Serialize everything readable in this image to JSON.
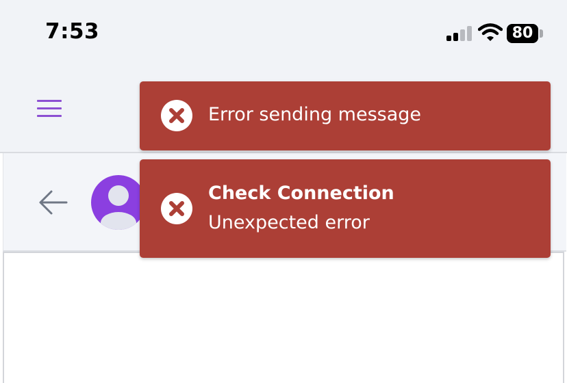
{
  "status_bar": {
    "time": "7:53",
    "battery_level": "80",
    "signal_bars_active": 2,
    "signal_bars_total": 4
  },
  "header": {
    "menu_icon": "hamburger-menu-icon",
    "accent_color": "#8c4fd2"
  },
  "chat": {
    "back_icon": "arrow-left-icon",
    "avatar_icon": "user-avatar-icon",
    "avatar_color": "#8b3fe0"
  },
  "toasts": [
    {
      "title": "",
      "message": "Error sending message",
      "icon": "error-x-circle-icon",
      "color": "#ac3f36"
    },
    {
      "title": "Check Connection",
      "message": "Unexpected error",
      "icon": "error-x-circle-icon",
      "color": "#ac3f36"
    }
  ]
}
